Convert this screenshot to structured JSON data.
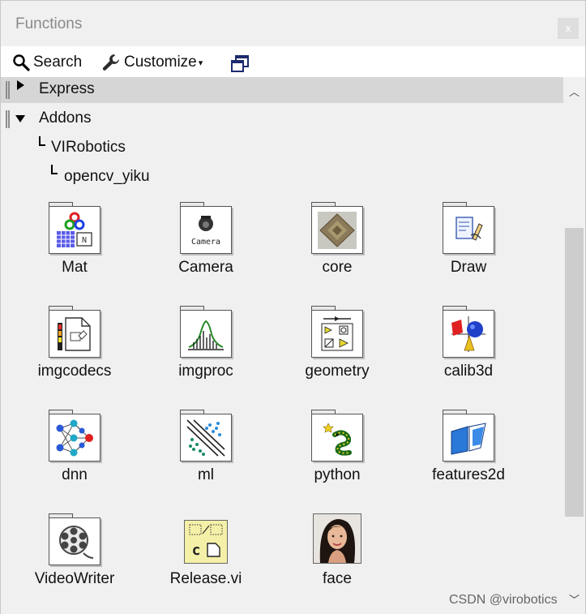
{
  "window": {
    "title": "Functions",
    "close_label": "x"
  },
  "toolbar": {
    "search_label": "Search",
    "customize_label": "Customize",
    "customize_caret": "▾"
  },
  "palette": {
    "express_label": "Express",
    "addons_label": "Addons",
    "tree": [
      {
        "label": "VIRobotics"
      },
      {
        "label": "opencv_yiku"
      }
    ],
    "items": [
      {
        "label": "Mat",
        "icon": "mat-icon"
      },
      {
        "label": "Camera",
        "icon": "camera-icon",
        "inner_text": "Camera"
      },
      {
        "label": "core",
        "icon": "core-chip-icon"
      },
      {
        "label": "Draw",
        "icon": "draw-icon"
      },
      {
        "label": "imgcodecs",
        "icon": "imgcodecs-icon"
      },
      {
        "label": "imgproc",
        "icon": "imgproc-histogram-icon"
      },
      {
        "label": "geometry",
        "icon": "geometry-icon"
      },
      {
        "label": "calib3d",
        "icon": "calib3d-shapes-icon"
      },
      {
        "label": "dnn",
        "icon": "dnn-network-icon"
      },
      {
        "label": "ml",
        "icon": "ml-scatter-icon"
      },
      {
        "label": "python",
        "icon": "python-icon"
      },
      {
        "label": "features2d",
        "icon": "features2d-icon"
      },
      {
        "label": "VideoWriter",
        "icon": "film-reel-icon"
      },
      {
        "label": "Release.vi",
        "icon": "release-vi-icon",
        "inner_text": "c"
      },
      {
        "label": "face",
        "icon": "face-photo-icon"
      }
    ]
  },
  "watermark": "CSDN @virobotics",
  "colors": {
    "background": "#f0f0f0",
    "header_highlight": "#d6d6d6",
    "scroll_thumb": "#cdcdcd"
  }
}
